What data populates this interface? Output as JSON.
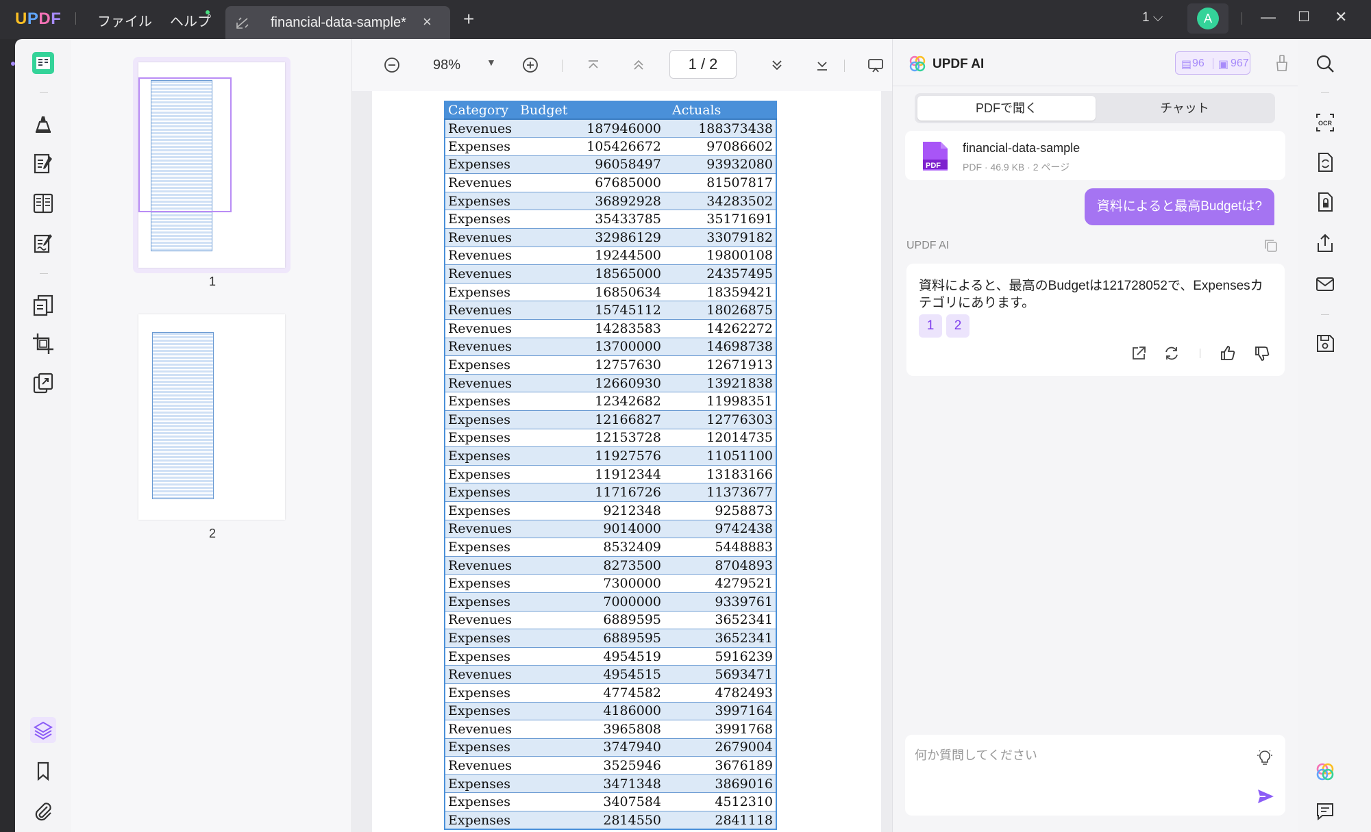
{
  "app": {
    "logo": [
      "U",
      "P",
      "D",
      "F"
    ],
    "menu": [
      "ファイル",
      "ヘルプ"
    ],
    "tab_title": "financial-data-sample*",
    "tab_close": "×",
    "tab_add": "+",
    "page_selector": "1",
    "avatar_letter": "A"
  },
  "thumbnails": [
    {
      "label": "1"
    },
    {
      "label": "2"
    }
  ],
  "doc_toolbar": {
    "zoom": "98%",
    "page_current": "1",
    "page_total": "2"
  },
  "table": {
    "headers": [
      "Category",
      "Budget",
      "Actuals"
    ],
    "rows": [
      [
        "Revenues",
        "187946000",
        "188373438"
      ],
      [
        "Expenses",
        "105426672",
        "97086602"
      ],
      [
        "Expenses",
        "96058497",
        "93932080"
      ],
      [
        "Revenues",
        "67685000",
        "81507817"
      ],
      [
        "Expenses",
        "36892928",
        "34283502"
      ],
      [
        "Expenses",
        "35433785",
        "35171691"
      ],
      [
        "Revenues",
        "32986129",
        "33079182"
      ],
      [
        "Revenues",
        "19244500",
        "19800108"
      ],
      [
        "Revenues",
        "18565000",
        "24357495"
      ],
      [
        "Expenses",
        "16850634",
        "18359421"
      ],
      [
        "Revenues",
        "15745112",
        "18026875"
      ],
      [
        "Revenues",
        "14283583",
        "14262272"
      ],
      [
        "Revenues",
        "13700000",
        "14698738"
      ],
      [
        "Expenses",
        "12757630",
        "12671913"
      ],
      [
        "Revenues",
        "12660930",
        "13921838"
      ],
      [
        "Expenses",
        "12342682",
        "11998351"
      ],
      [
        "Expenses",
        "12166827",
        "12776303"
      ],
      [
        "Expenses",
        "12153728",
        "12014735"
      ],
      [
        "Expenses",
        "11927576",
        "11051100"
      ],
      [
        "Expenses",
        "11912344",
        "13183166"
      ],
      [
        "Expenses",
        "11716726",
        "11373677"
      ],
      [
        "Expenses",
        "9212348",
        "9258873"
      ],
      [
        "Revenues",
        "9014000",
        "9742438"
      ],
      [
        "Expenses",
        "8532409",
        "5448883"
      ],
      [
        "Revenues",
        "8273500",
        "8704893"
      ],
      [
        "Expenses",
        "7300000",
        "4279521"
      ],
      [
        "Expenses",
        "7000000",
        "9339761"
      ],
      [
        "Revenues",
        "6889595",
        "3652341"
      ],
      [
        "Expenses",
        "6889595",
        "3652341"
      ],
      [
        "Expenses",
        "4954519",
        "5916239"
      ],
      [
        "Revenues",
        "4954515",
        "5693471"
      ],
      [
        "Expenses",
        "4774582",
        "4782493"
      ],
      [
        "Expenses",
        "4186000",
        "3997164"
      ],
      [
        "Revenues",
        "3965808",
        "3991768"
      ],
      [
        "Expenses",
        "3747940",
        "2679004"
      ],
      [
        "Revenues",
        "3525946",
        "3676189"
      ],
      [
        "Expenses",
        "3471348",
        "3869016"
      ],
      [
        "Expenses",
        "3407584",
        "4512310"
      ],
      [
        "Expenses",
        "2814550",
        "2841118"
      ]
    ]
  },
  "ai_panel": {
    "title": "UPDF AI",
    "credits_docs": "96",
    "credits_chat": "967",
    "tabs": [
      "PDFで聞く",
      "チャット"
    ],
    "file_name": "financial-data-sample",
    "file_meta": "PDF · 46.9 KB · 2 ページ",
    "file_badge": "PDF",
    "user_message": "資料によると最高Budgetは?",
    "ai_name": "UPDF AI",
    "ai_answer": "資料によると、最高のBudgetは121728052で、Expensesカテゴリにあります。",
    "references": [
      "1",
      "2"
    ],
    "input_placeholder": "何か質問してください"
  },
  "colors": {
    "accent": "#a574f2",
    "table_header": "#4a90d9",
    "table_stripe": "#dce9f7"
  }
}
